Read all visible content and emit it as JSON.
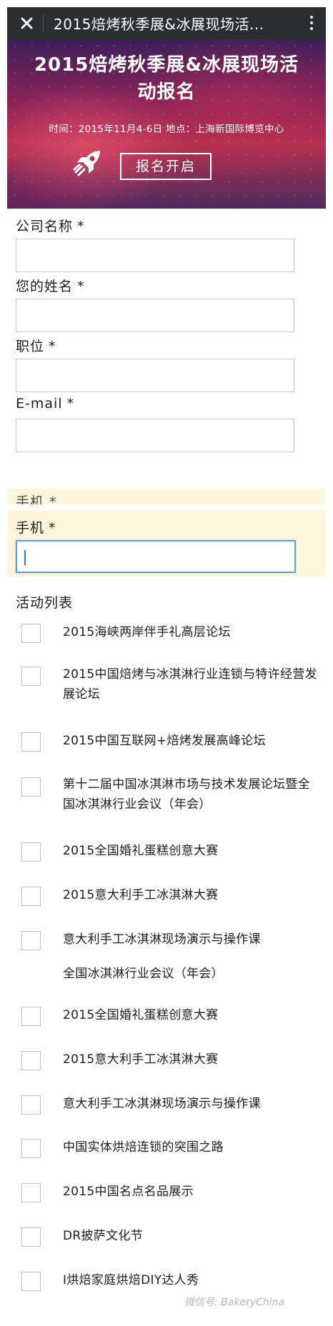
{
  "topbar": {
    "title": "2015焙烤秋季展&冰展现场活..."
  },
  "banner": {
    "title_line1": "2015焙烤秋季展&冰展现场活",
    "title_line2": "动报名",
    "info": "时间：2015年11月4-6日 地点：上海新国际博览中心",
    "button": "报名开启"
  },
  "form": {
    "fields": [
      {
        "label": "公司名称",
        "required": "*",
        "value": ""
      },
      {
        "label": "您的姓名",
        "required": "*",
        "value": ""
      },
      {
        "label": "职位",
        "required": "*",
        "value": ""
      },
      {
        "label": "E-mail",
        "required": "*",
        "value": ""
      }
    ],
    "phone_ghost": "手机 *",
    "phone": {
      "label": "手机",
      "required": "*",
      "value": ""
    },
    "list_label": "活动列表",
    "activities": [
      "2015海峡两岸伴手礼高层论坛",
      "2015中国焙烤与冰淇淋行业连锁与特许经营发展论坛",
      "2015中国互联网+焙烤发展高峰论坛",
      "第十二届中国冰淇淋市场与技术发展论坛暨全国冰淇淋行业会议（年会）",
      "2015全国婚礼蛋糕创意大赛",
      "2015意大利手工冰淇淋大赛",
      "意大利手工冰淇淋现场演示与操作课",
      "全国冰淇淋行业会议（年会）",
      "2015全国婚礼蛋糕创意大赛",
      "2015意大利手工冰淇淋大赛",
      "意大利手工冰淇淋现场演示与操作课",
      "中国实体烘焙连锁的突围之路",
      "2015中国名点名品展示",
      "DR披萨文化节",
      "I烘焙家庭烘焙DIY达人秀"
    ]
  },
  "watermark": "微信号: BakeryChina"
}
